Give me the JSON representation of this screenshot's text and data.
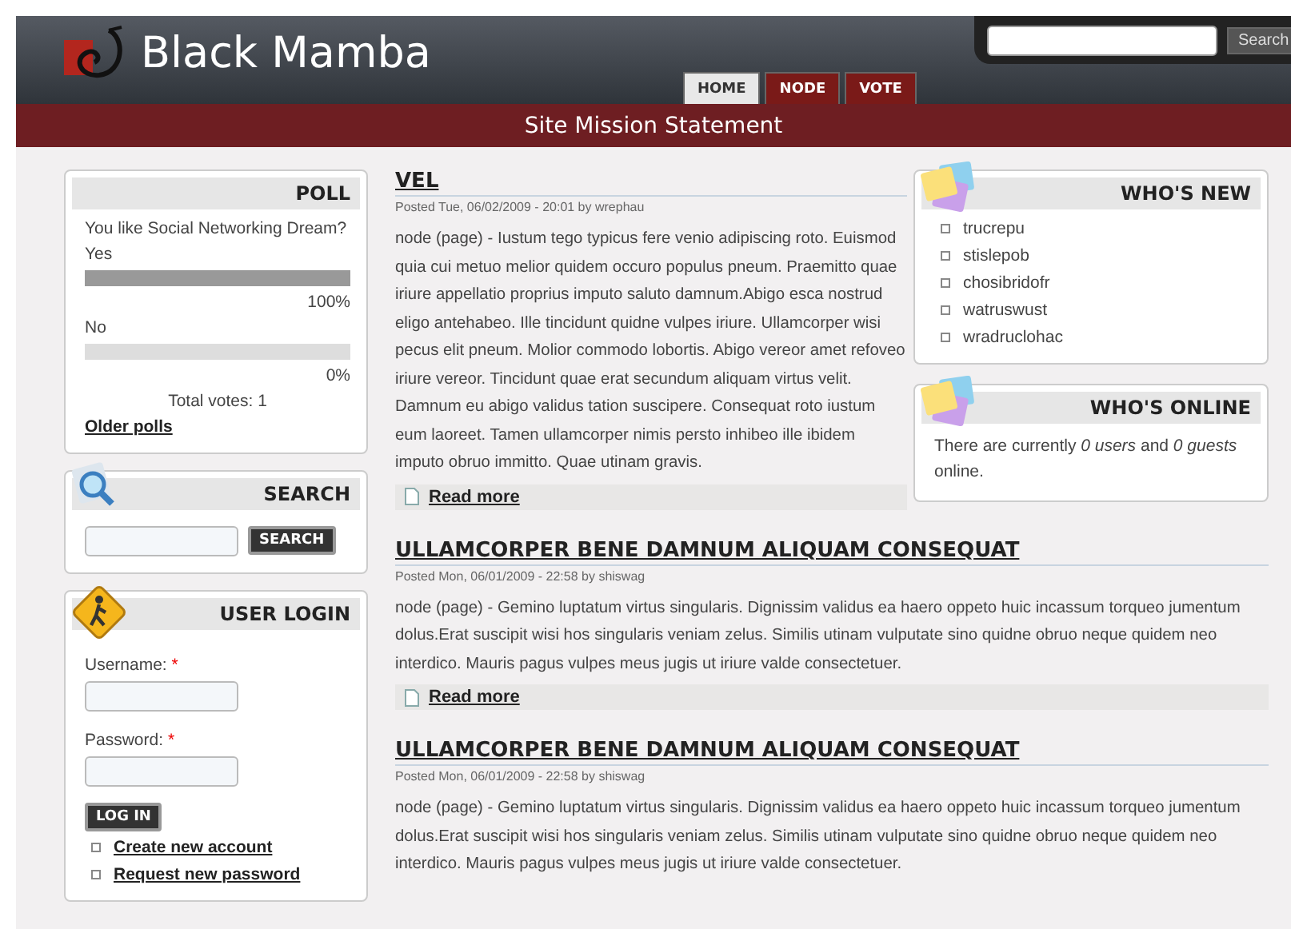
{
  "header": {
    "site_name": "Black Mamba",
    "search": {
      "button": "Search"
    },
    "tabs": [
      {
        "label": "HOME",
        "selected": true
      },
      {
        "label": "NODE",
        "selected": false
      },
      {
        "label": "VOTE",
        "selected": false
      }
    ]
  },
  "mission": "Site Mission Statement",
  "left_sidebar": {
    "poll": {
      "title": "POLL",
      "question": "You like Social Networking Dream?",
      "choices": [
        {
          "label": "Yes",
          "level": 1,
          "percent": "100%"
        },
        {
          "label": "No",
          "level": 0,
          "percent": "0%"
        }
      ],
      "total": "Total votes: 1",
      "older": "Older polls"
    },
    "search": {
      "title": "SEARCH",
      "button": "SEARCH"
    },
    "login": {
      "title": "USER LOGIN",
      "username_label": "Username:",
      "password_label": "Password:",
      "required": "*",
      "button": "LOG IN",
      "links": [
        "Create new account",
        "Request new password"
      ]
    }
  },
  "right_sidebar": {
    "whos_new": {
      "title": "WHO'S NEW",
      "users": [
        "trucrepu",
        "stislepob",
        "chosibridofr",
        "watruswust",
        "wradruclohac"
      ]
    },
    "whos_online": {
      "title": "WHO'S ONLINE",
      "text": "There are currently *0 users* and *0 guests* online."
    }
  },
  "posts": [
    {
      "title": "VEL",
      "meta": "Posted Tue, 06/02/2009 - 20:01 by wrephau",
      "body": "node (page) - Iustum tego typicus fere venio adipiscing roto. Euismod quia cui metuo melior quidem occuro populus pneum. Praemitto quae iriure appellatio proprius imputo saluto damnum.Abigo esca nostrud eligo antehabeo. Ille tincidunt quidne vulpes iriure. Ullamcorper wisi pecus elit pneum. Molior commodo lobortis. Abigo vereor amet refoveo iriure vereor. Tincidunt quae erat secundum aliquam virtus velit. Damnum eu abigo validus tation suscipere. Consequat roto iustum eum laoreet. Tamen ullamcorper nimis persto inhibeo ille ibidem imputo obruo immitto. Quae utinam gravis.",
      "read_more": "Read more"
    },
    {
      "title": "ULLAMCORPER BENE DAMNUM ALIQUAM CONSEQUAT",
      "meta": "Posted Mon, 06/01/2009 - 22:58 by shiswag",
      "body": "node (page) - Gemino luptatum virtus singularis. Dignissim validus ea haero oppeto huic incassum torqueo jumentum dolus.Erat suscipit wisi hos singularis veniam zelus. Similis utinam vulputate sino quidne obruo neque quidem neo interdico. Mauris pagus vulpes meus jugis ut iriure valde consectetuer.",
      "read_more": "Read more"
    },
    {
      "title": "ULLAMCORPER BENE DAMNUM ALIQUAM CONSEQUAT",
      "meta": "Posted Mon, 06/01/2009 - 22:58 by shiswag",
      "body": "node (page) - Gemino luptatum virtus singularis. Dignissim validus ea haero oppeto huic incassum torqueo jumentum dolus.Erat suscipit wisi hos singularis veniam zelus. Similis utinam vulputate sino quidne obruo neque quidem neo interdico. Mauris pagus vulpes meus jugis ut iriure valde consectetuer."
    }
  ]
}
